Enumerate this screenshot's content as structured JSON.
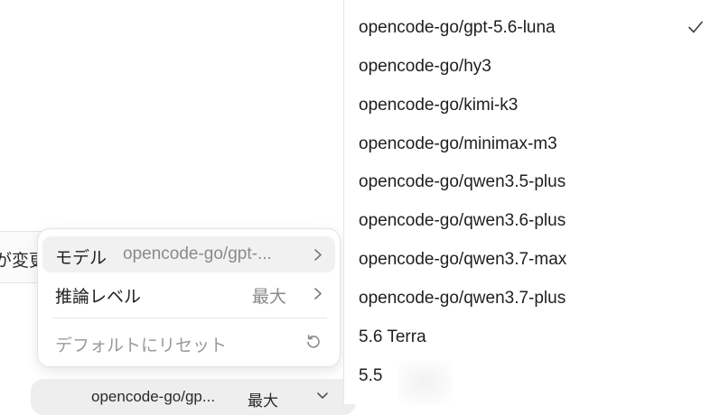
{
  "background": {
    "cut_text": "が変更",
    "bottom_bar": {
      "model": "opencode-go/gp...",
      "level": "最大"
    }
  },
  "menu": {
    "items": [
      {
        "label": "モデル",
        "value": "opencode-go/gpt-...",
        "icon": "chevron-right-icon"
      },
      {
        "label": "推論レベル",
        "value": "最大",
        "icon": "chevron-right-icon"
      }
    ],
    "reset": {
      "label": "デフォルトにリセット",
      "icon": "reset-icon"
    }
  },
  "models": {
    "selected_index": 0,
    "items": [
      "opencode-go/gpt-5.6-luna",
      "opencode-go/hy3",
      "opencode-go/kimi-k3",
      "opencode-go/minimax-m3",
      "opencode-go/qwen3.5-plus",
      "opencode-go/qwen3.6-plus",
      "opencode-go/qwen3.7-max",
      "opencode-go/qwen3.7-plus",
      "5.6 Terra",
      "5.5"
    ]
  },
  "colors": {
    "text": "#1f1f1f",
    "muted": "#8a8a8a",
    "hover": "#f1f1f1"
  }
}
